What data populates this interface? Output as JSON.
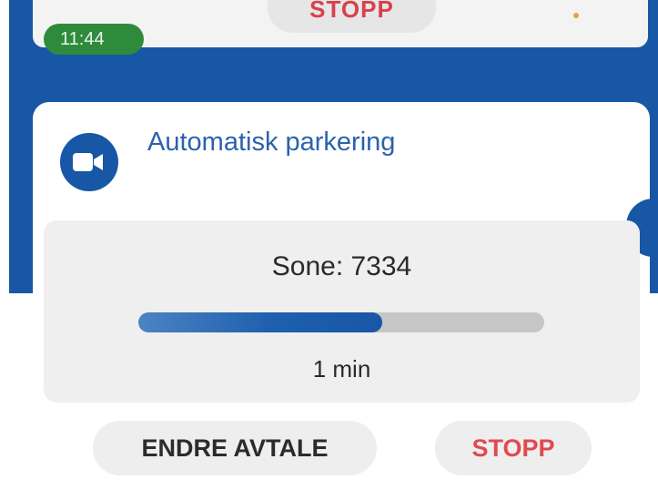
{
  "status_bar": {
    "time": "11:44",
    "peek_card_button": "STOPP"
  },
  "card": {
    "icon": "video-camera-icon",
    "title": "Automatisk parkering",
    "zone_label": "Sone: 7334",
    "progress_fraction": 0.6,
    "duration": "1 min",
    "buttons": {
      "change": "ENDRE AVTALE",
      "stop": "STOPP"
    }
  },
  "colors": {
    "primary": "#1757a6",
    "stop": "#e04a50",
    "time_badge": "#2e8b3b"
  }
}
